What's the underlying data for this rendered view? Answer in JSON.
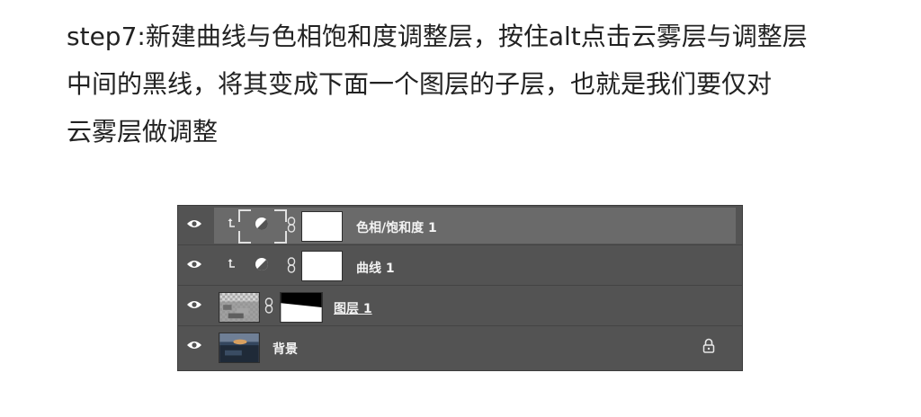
{
  "instructions": {
    "lines": [
      "step7:新建曲线与色相饱和度调整层，按住alt点击云雾层与调整层",
      "中间的黑线，将其变成下面一个图层的子层，也就是我们要仅对",
      "云雾层做调整"
    ]
  },
  "layers_panel": {
    "layers": [
      {
        "name": "色相/饱和度 1",
        "type": "adjustment",
        "clipped": true,
        "selected": true
      },
      {
        "name": "曲线 1",
        "type": "adjustment",
        "clipped": true,
        "selected": false
      },
      {
        "name": "图层 1",
        "type": "pixel-with-mask",
        "clipped": false,
        "selected": false
      },
      {
        "name": "背景",
        "type": "background",
        "locked": true,
        "selected": false
      }
    ],
    "colors": {
      "panel_bg": "#535353",
      "selected_row_bg": "#6a6a6a",
      "text": "#f2f2f2"
    }
  }
}
